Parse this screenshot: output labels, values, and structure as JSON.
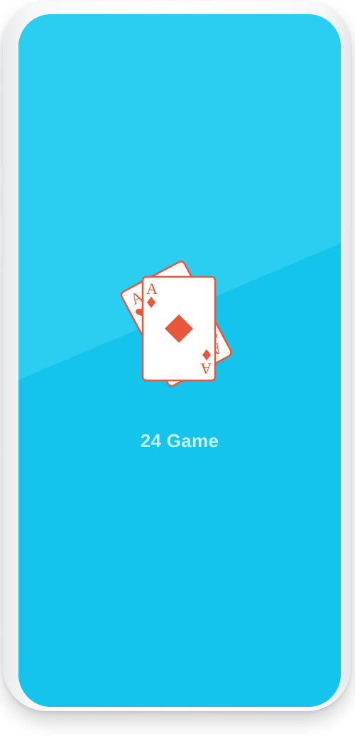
{
  "app": {
    "title": "24 Game"
  },
  "logo": {
    "icon": "playing-cards-icon",
    "back_card_rank": "A",
    "front_card_rank": "A"
  },
  "colors": {
    "screen_background": "#14c4ec",
    "card_accent": "#e8563c",
    "title_text": "#c8f2fc"
  }
}
